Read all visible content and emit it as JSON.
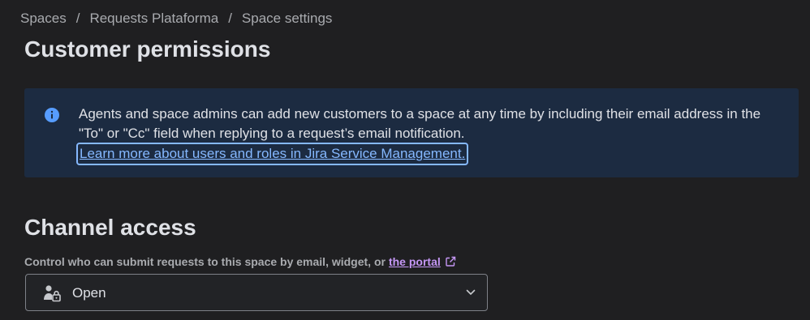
{
  "breadcrumb": {
    "items": [
      "Spaces",
      "Requests Plataforma",
      "Space settings"
    ],
    "separator": "/"
  },
  "page": {
    "title": "Customer permissions"
  },
  "info_panel": {
    "icon": "info-icon",
    "text": "Agents and space admins can add new customers to a space at any time by including their email address in the \"To\" or \"Cc\" field when replying to a request’s email notification.",
    "link_text": "Learn more about users and roles in Jira Service Management."
  },
  "channel_access": {
    "title": "Channel access",
    "label_prefix": "Control who can submit requests to this space by email, widget, or",
    "portal_link": "the portal",
    "portal_link_icon": "external-link-icon",
    "select": {
      "icon": "person-lock-icon",
      "value": "Open",
      "chevron_icon": "chevron-down-icon"
    }
  },
  "colors": {
    "background": "#1f1f21",
    "info_background": "#1c2b41",
    "info_icon": "#579dff",
    "link": "#85b8ff",
    "portal_link": "#c597f5"
  }
}
